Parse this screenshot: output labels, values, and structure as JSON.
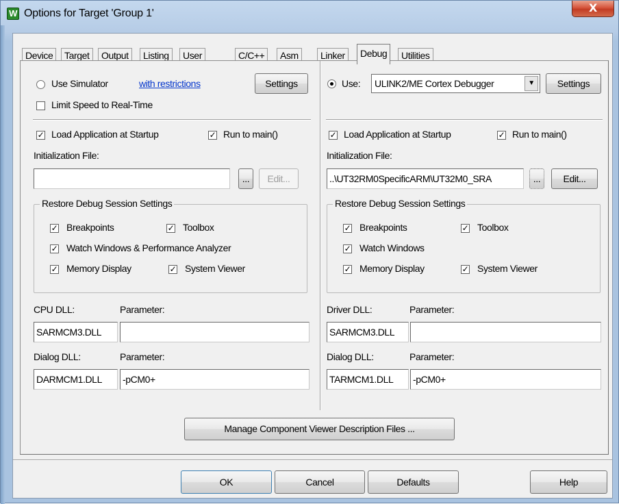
{
  "window": {
    "title": "Options for Target 'Group 1'",
    "app_icon": "W",
    "close_label": "X"
  },
  "tabs": [
    {
      "label": "Device"
    },
    {
      "label": "Target"
    },
    {
      "label": "Output"
    },
    {
      "label": "Listing"
    },
    {
      "label": "User"
    },
    {
      "label": "C/C++"
    },
    {
      "label": "Asm"
    },
    {
      "label": "Linker"
    },
    {
      "label": "Debug",
      "active": true
    },
    {
      "label": "Utilities"
    }
  ],
  "left": {
    "use_simulator": {
      "label": "Use Simulator",
      "selected": false
    },
    "restrictions_link": "with restrictions",
    "settings_button": "Settings",
    "limit_speed": {
      "label": "Limit Speed to Real-Time",
      "checked": false
    },
    "load_app": {
      "label": "Load Application at Startup",
      "checked": true
    },
    "run_to_main": {
      "label": "Run to main()",
      "checked": true
    },
    "init_file_label": "Initialization File:",
    "init_file_value": "",
    "browse_button": "...",
    "edit_button": "Edit...",
    "restore_group": {
      "title": "Restore Debug Session Settings",
      "breakpoints": "Breakpoints",
      "toolbox": "Toolbox",
      "watch": "Watch Windows & Performance Analyzer",
      "memory": "Memory Display",
      "system_viewer": "System Viewer"
    },
    "cpu_dll_label": "CPU DLL:",
    "cpu_param_label": "Parameter:",
    "cpu_dll_value": "SARMCM3.DLL",
    "cpu_param_value": "",
    "dialog_dll_label": "Dialog DLL:",
    "dialog_param_label": "Parameter:",
    "dialog_dll_value": "DARMCM1.DLL",
    "dialog_param_value": "-pCM0+"
  },
  "right": {
    "use": {
      "label": "Use:",
      "selected": true
    },
    "debugger_select": "ULINK2/ME Cortex Debugger",
    "settings_button": "Settings",
    "load_app": {
      "label": "Load Application at Startup",
      "checked": true
    },
    "run_to_main": {
      "label": "Run to main()",
      "checked": true
    },
    "init_file_label": "Initialization File:",
    "init_file_value": "..\\UT32RM0SpecificARM\\UT32M0_SRA",
    "browse_button": "...",
    "edit_button": "Edit...",
    "restore_group": {
      "title": "Restore Debug Session Settings",
      "breakpoints": "Breakpoints",
      "toolbox": "Toolbox",
      "watch": "Watch Windows",
      "memory": "Memory Display",
      "system_viewer": "System Viewer"
    },
    "driver_dll_label": "Driver DLL:",
    "driver_param_label": "Parameter:",
    "driver_dll_value": "SARMCM3.DLL",
    "driver_param_value": "",
    "dialog_dll_label": "Dialog DLL:",
    "dialog_param_label": "Parameter:",
    "dialog_dll_value": "TARMCM1.DLL",
    "dialog_param_value": "-pCM0+"
  },
  "manage_button": "Manage Component Viewer Description Files ...",
  "footer": {
    "ok": "OK",
    "cancel": "Cancel",
    "defaults": "Defaults",
    "help": "Help"
  },
  "check_mark": "✓"
}
